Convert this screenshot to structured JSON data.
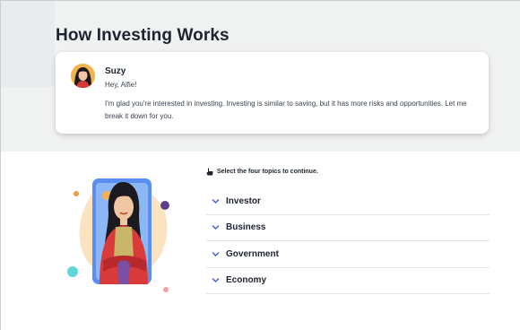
{
  "page": {
    "title": "How Investing Works"
  },
  "card": {
    "speaker": "Suzy",
    "greeting": "Hey, Alfie!",
    "message": "I'm glad you're interested in investing. Investing is similar to saving, but it has more risks and opportunities. Let me break it down for you."
  },
  "instruction": {
    "icon": "pointing-hand-icon",
    "text": "Select the four topics to continue."
  },
  "topics": [
    {
      "label": "Investor",
      "icon": "chevron-down-icon"
    },
    {
      "label": "Business",
      "icon": "chevron-down-icon"
    },
    {
      "label": "Government",
      "icon": "chevron-down-icon"
    },
    {
      "label": "Economy",
      "icon": "chevron-down-icon"
    }
  ],
  "colors": {
    "accent": "#3d63d8",
    "hero_bg": "#f0f1f1",
    "phone_blue": "#5a8ff0",
    "jacket_red": "#d93a3a",
    "blob_peach": "#fbe3c2"
  }
}
